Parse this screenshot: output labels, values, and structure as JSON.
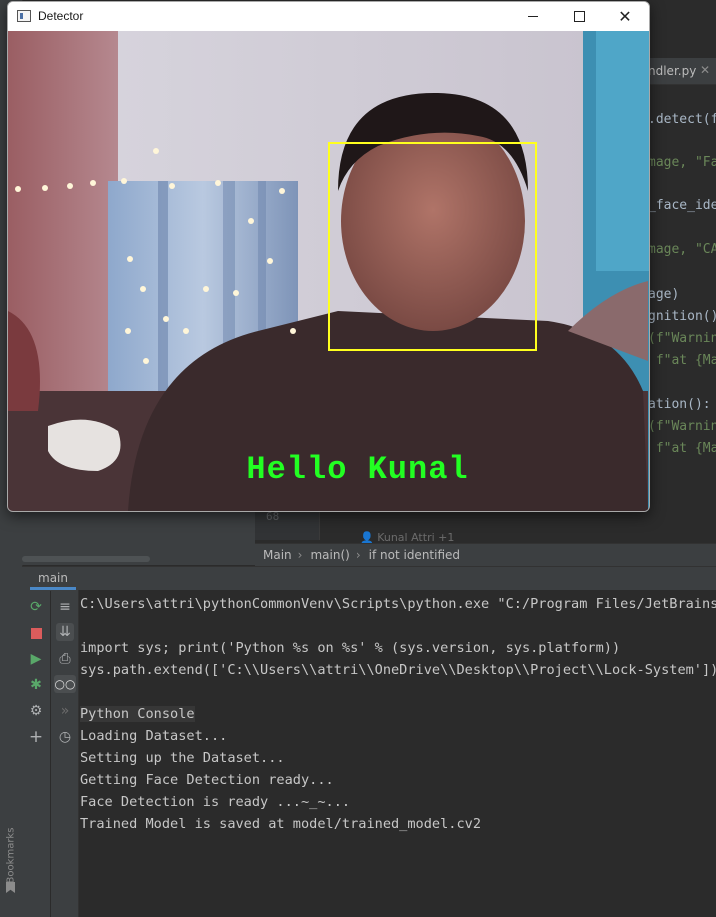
{
  "ide": {
    "editor_tab_label": "ndler.py",
    "code_fragments": [
      {
        "text": ".detect(f",
        "kind": "code"
      },
      {
        "text": "mage, \"Fa",
        "kind": "string"
      },
      {
        "text": "_face_ide",
        "kind": "code"
      },
      {
        "text": "mage, \"CA",
        "kind": "string"
      },
      {
        "text": "age)",
        "kind": "code"
      },
      {
        "text": "gnition()",
        "kind": "code"
      },
      {
        "text": "(f\"Warnin",
        "kind": "string"
      },
      {
        "text": " f\"at {Ma",
        "kind": "string"
      },
      {
        "text": "ation():",
        "kind": "code"
      },
      {
        "text": "(f\"Warnin",
        "kind": "string"
      },
      {
        "text": " f\"at {Ma",
        "kind": "string"
      }
    ],
    "gutter_line": "68",
    "inlay_author": "Kunal Attri +1",
    "breadcrumb": [
      "Main",
      "main()",
      "if not identified"
    ],
    "run_tab": "main",
    "bookmarks_label": "Bookmarks",
    "console": {
      "lines": [
        "C:\\Users\\attri\\pythonCommonVenv\\Scripts\\python.exe \"C:/Program Files/JetBrains/P",
        "",
        "import sys; print('Python %s on %s' % (sys.version, sys.platform))",
        "sys.path.extend(['C:\\\\Users\\\\attri\\\\OneDrive\\\\Desktop\\\\Project\\\\Lock-System'])",
        "",
        "Python Console",
        "Loading Dataset...",
        "Setting up the Dataset...",
        "Getting Face Detection ready...",
        "Face Detection is ready ...~_~...",
        "Trained Model is saved at model/trained_model.cv2"
      ]
    },
    "toolbar_icons_left": [
      "rerun-icon",
      "stop-icon",
      "run-icon",
      "debug-icon",
      "settings-icon",
      "add-icon"
    ],
    "toolbar_icons_right": [
      "soft-wrap-icon",
      "scroll-to-end-icon",
      "print-icon",
      "glasses-icon",
      "forward-icon",
      "history-icon"
    ]
  },
  "detector": {
    "title": "Detector",
    "overlay_text": "Hello Kunal",
    "face_box_color": "#ffff1e",
    "overlay_color": "#22ff22"
  }
}
